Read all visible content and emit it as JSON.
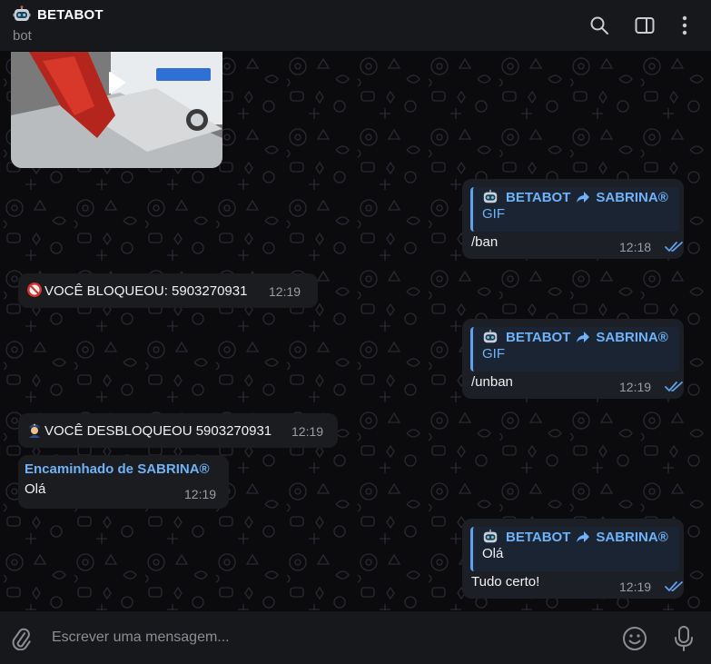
{
  "header": {
    "chat_name": "BETABOT",
    "status": "bot"
  },
  "messages": [
    {
      "type": "video",
      "direction": "in"
    },
    {
      "type": "forward",
      "direction": "out",
      "from": "BETABOT",
      "to": "SABRINA®",
      "quoted": "GIF",
      "text": "/ban",
      "time": "12:18",
      "read": true
    },
    {
      "type": "text",
      "direction": "in",
      "text": "VOCÊ BLOQUEOU: 5903270931",
      "time": "12:19",
      "emoji": "no-entry"
    },
    {
      "type": "forward",
      "direction": "out",
      "from": "BETABOT",
      "to": "SABRINA®",
      "quoted": "GIF",
      "text": "/unban",
      "time": "12:19",
      "read": true
    },
    {
      "type": "text",
      "direction": "in",
      "text": "VOCÊ DESBLOQUEOU 5903270931",
      "time": "12:19",
      "emoji": "police-officer"
    },
    {
      "type": "forwarded",
      "direction": "in",
      "forwarded_label": "Encaminhado de SABRINA®",
      "text": "Olá",
      "time": "12:19"
    },
    {
      "type": "forward",
      "direction": "out",
      "from": "BETABOT",
      "to": "SABRINA®",
      "quoted": "Olá",
      "text": "Tudo certo!",
      "time": "12:19",
      "read": true
    }
  ],
  "compose": {
    "placeholder": "Escrever uma mensagem..."
  },
  "icons": {
    "header": [
      "search-icon",
      "sidebar-toggle-icon",
      "more-icon"
    ],
    "compose": [
      "attach-icon",
      "emoji-icon",
      "mic-icon"
    ]
  },
  "colors": {
    "accent": "#6fb2f7",
    "header_bg": "#17181b",
    "bubble_bg": "#1b1c20",
    "check": "#5fa1ec"
  }
}
